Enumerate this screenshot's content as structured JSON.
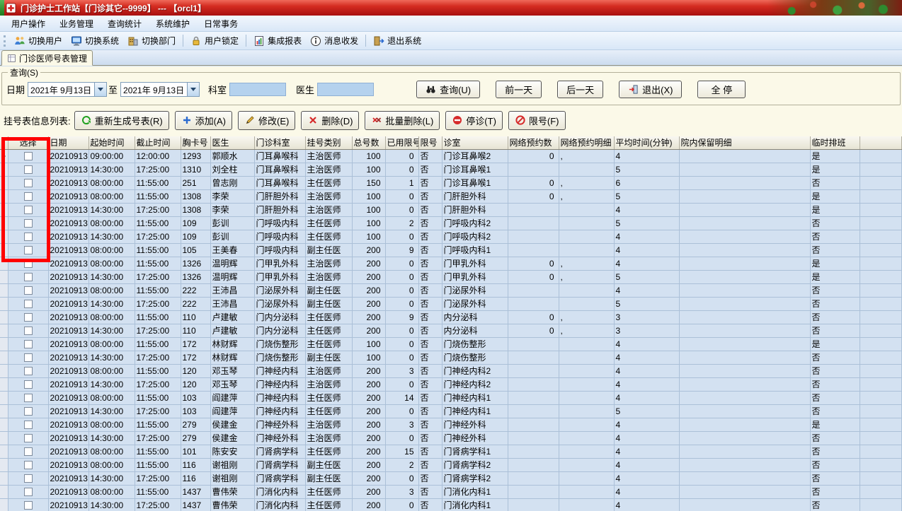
{
  "window": {
    "title": "门诊护士工作站【门诊其它--9999】 --- 【orcl1】"
  },
  "menu": {
    "items": [
      {
        "id": "user-ops",
        "label": "用户操作"
      },
      {
        "id": "business",
        "label": "业务管理"
      },
      {
        "id": "query-stats",
        "label": "查询统计"
      },
      {
        "id": "system-maint",
        "label": "系统维护"
      },
      {
        "id": "daily-affairs",
        "label": "日常事务"
      }
    ]
  },
  "toolbar": {
    "groups": [
      [
        {
          "id": "switch-user",
          "icon": "switch-user",
          "label": "切换用户"
        },
        {
          "id": "switch-system",
          "icon": "switch-system",
          "label": "切换系统"
        },
        {
          "id": "switch-dept",
          "icon": "switch-dept",
          "label": "切换部门"
        }
      ],
      [
        {
          "id": "lock-user",
          "icon": "lock-user",
          "label": "用户锁定"
        }
      ],
      [
        {
          "id": "integrated-report",
          "icon": "report",
          "label": "集成报表"
        },
        {
          "id": "messages",
          "icon": "message",
          "label": "消息收发"
        }
      ],
      [
        {
          "id": "exit-system",
          "icon": "exit",
          "label": "退出系统"
        }
      ]
    ]
  },
  "tabs": {
    "active": "门诊医师号表管理"
  },
  "query": {
    "group_label": "查询(S)",
    "date_label": "日期",
    "date_from": "2021年 9月13日",
    "to_label": "至",
    "date_to": "2021年 9月13日",
    "dept_label": "科室",
    "dept_value": "",
    "doctor_label": "医生",
    "doctor_value": "",
    "search_button": "查询(U)",
    "prev_day_button": "前一天",
    "next_day_button": "后一天",
    "exit_button": "退出(X)",
    "stop_all_button": "全 停"
  },
  "actions": {
    "label": "挂号表信息列表:",
    "buttons": [
      {
        "id": "regenerate",
        "icon": "refresh",
        "label": "重新生成号表(R)"
      },
      {
        "id": "add",
        "icon": "add",
        "label": "添加(A)"
      },
      {
        "id": "edit",
        "icon": "edit",
        "label": "修改(E)"
      },
      {
        "id": "delete",
        "icon": "delete",
        "label": "删除(D)"
      },
      {
        "id": "batch-delete",
        "icon": "batch-delete",
        "label": "批量删除(L)"
      },
      {
        "id": "stop-visit",
        "icon": "stop-visit",
        "label": "停诊(T)"
      },
      {
        "id": "limit-number",
        "icon": "limit",
        "label": "限号(F)"
      }
    ]
  },
  "table": {
    "columns": [
      "选择",
      "日期",
      "起始时间",
      "截止时间",
      "胸卡号",
      "医生",
      "门诊科室",
      "挂号类别",
      "总号数",
      "已用限号",
      "限号",
      "诊室",
      "网络预约数",
      "网络预约明细",
      "平均时间(分钟)",
      "院内保留明细",
      "临时排班"
    ],
    "rows": [
      [
        "20210913",
        "09:00:00",
        "12:00:00",
        "1293",
        "郭顺水",
        "门耳鼻喉科",
        "主治医师",
        "100",
        "0",
        "否",
        "门诊耳鼻喉2",
        "0",
        ",",
        "4",
        "",
        "是"
      ],
      [
        "20210913",
        "14:30:00",
        "17:25:00",
        "1310",
        "刘全柱",
        "门耳鼻喉科",
        "主治医师",
        "100",
        "0",
        "否",
        "门诊耳鼻喉1",
        "",
        "",
        "5",
        "",
        "是"
      ],
      [
        "20210913",
        "08:00:00",
        "11:55:00",
        "251",
        "曾志刚",
        "门耳鼻喉科",
        "主任医师",
        "150",
        "1",
        "否",
        "门诊耳鼻喉1",
        "0",
        ",",
        "6",
        "",
        "否"
      ],
      [
        "20210913",
        "08:00:00",
        "11:55:00",
        "1308",
        "李荣",
        "门肝胆外科",
        "主治医师",
        "100",
        "0",
        "否",
        "门肝胆外科",
        "0",
        ",",
        "5",
        "",
        "是"
      ],
      [
        "20210913",
        "14:30:00",
        "17:25:00",
        "1308",
        "李荣",
        "门肝胆外科",
        "主治医师",
        "100",
        "0",
        "否",
        "门肝胆外科",
        "",
        "",
        "4",
        "",
        "是"
      ],
      [
        "20210913",
        "08:00:00",
        "11:55:00",
        "109",
        "彭训",
        "门呼吸内科",
        "主任医师",
        "100",
        "2",
        "否",
        "门呼吸内科2",
        "",
        "",
        "5",
        "",
        "否"
      ],
      [
        "20210913",
        "14:30:00",
        "17:25:00",
        "109",
        "彭训",
        "门呼吸内科",
        "主任医师",
        "100",
        "0",
        "否",
        "门呼吸内科2",
        "",
        "",
        "4",
        "",
        "否"
      ],
      [
        "20210913",
        "08:00:00",
        "11:55:00",
        "105",
        "王美春",
        "门呼吸内科",
        "副主任医",
        "200",
        "9",
        "否",
        "门呼吸内科1",
        "",
        "",
        "4",
        "",
        "否"
      ],
      [
        "20210913",
        "08:00:00",
        "11:55:00",
        "1326",
        "温明辉",
        "门甲乳外科",
        "主治医师",
        "200",
        "0",
        "否",
        "门甲乳外科",
        "0",
        ",",
        "4",
        "",
        "是"
      ],
      [
        "20210913",
        "14:30:00",
        "17:25:00",
        "1326",
        "温明辉",
        "门甲乳外科",
        "主治医师",
        "200",
        "0",
        "否",
        "门甲乳外科",
        "0",
        ",",
        "5",
        "",
        "是"
      ],
      [
        "20210913",
        "08:00:00",
        "11:55:00",
        "222",
        "王沛昌",
        "门泌尿外科",
        "副主任医",
        "200",
        "0",
        "否",
        "门泌尿外科",
        "",
        "",
        "4",
        "",
        "否"
      ],
      [
        "20210913",
        "14:30:00",
        "17:25:00",
        "222",
        "王沛昌",
        "门泌尿外科",
        "副主任医",
        "200",
        "0",
        "否",
        "门泌尿外科",
        "",
        "",
        "5",
        "",
        "否"
      ],
      [
        "20210913",
        "08:00:00",
        "11:55:00",
        "110",
        "卢建敏",
        "门内分泌科",
        "主任医师",
        "200",
        "9",
        "否",
        "内分泌科",
        "0",
        ",",
        "3",
        "",
        "否"
      ],
      [
        "20210913",
        "14:30:00",
        "17:25:00",
        "110",
        "卢建敏",
        "门内分泌科",
        "主任医师",
        "200",
        "0",
        "否",
        "内分泌科",
        "0",
        ",",
        "3",
        "",
        "否"
      ],
      [
        "20210913",
        "08:00:00",
        "11:55:00",
        "172",
        "林财辉",
        "门烧伤整形",
        "主任医师",
        "100",
        "0",
        "否",
        "门烧伤整形",
        "",
        "",
        "4",
        "",
        "是"
      ],
      [
        "20210913",
        "14:30:00",
        "17:25:00",
        "172",
        "林财辉",
        "门烧伤整形",
        "副主任医",
        "100",
        "0",
        "否",
        "门烧伤整形",
        "",
        "",
        "4",
        "",
        "否"
      ],
      [
        "20210913",
        "08:00:00",
        "11:55:00",
        "120",
        "邓玉琴",
        "门神经内科",
        "主治医师",
        "200",
        "3",
        "否",
        "门神经内科2",
        "",
        "",
        "4",
        "",
        "否"
      ],
      [
        "20210913",
        "14:30:00",
        "17:25:00",
        "120",
        "邓玉琴",
        "门神经内科",
        "主治医师",
        "200",
        "0",
        "否",
        "门神经内科2",
        "",
        "",
        "4",
        "",
        "否"
      ],
      [
        "20210913",
        "08:00:00",
        "11:55:00",
        "103",
        "阎建萍",
        "门神经内科",
        "主任医师",
        "200",
        "14",
        "否",
        "门神经内科1",
        "",
        "",
        "4",
        "",
        "否"
      ],
      [
        "20210913",
        "14:30:00",
        "17:25:00",
        "103",
        "阎建萍",
        "门神经内科",
        "主任医师",
        "200",
        "0",
        "否",
        "门神经内科1",
        "",
        "",
        "5",
        "",
        "否"
      ],
      [
        "20210913",
        "08:00:00",
        "11:55:00",
        "279",
        "侯建金",
        "门神经外科",
        "主治医师",
        "200",
        "3",
        "否",
        "门神经外科",
        "",
        "",
        "4",
        "",
        "是"
      ],
      [
        "20210913",
        "14:30:00",
        "17:25:00",
        "279",
        "侯建金",
        "门神经外科",
        "主治医师",
        "200",
        "0",
        "否",
        "门神经外科",
        "",
        "",
        "4",
        "",
        "否"
      ],
      [
        "20210913",
        "08:00:00",
        "11:55:00",
        "101",
        "陈安安",
        "门肾病学科",
        "主任医师",
        "200",
        "15",
        "否",
        "门肾病学科1",
        "",
        "",
        "4",
        "",
        "否"
      ],
      [
        "20210913",
        "08:00:00",
        "11:55:00",
        "116",
        "谢祖刚",
        "门肾病学科",
        "副主任医",
        "200",
        "2",
        "否",
        "门肾病学科2",
        "",
        "",
        "4",
        "",
        "否"
      ],
      [
        "20210913",
        "14:30:00",
        "17:25:00",
        "116",
        "谢祖刚",
        "门肾病学科",
        "副主任医",
        "200",
        "0",
        "否",
        "门肾病学科2",
        "",
        "",
        "4",
        "",
        "否"
      ],
      [
        "20210913",
        "08:00:00",
        "11:55:00",
        "1437",
        "曹伟荣",
        "门消化内科",
        "主任医师",
        "200",
        "3",
        "否",
        "门消化内科1",
        "",
        "",
        "4",
        "",
        "否"
      ],
      [
        "20210913",
        "14:30:00",
        "17:25:00",
        "1437",
        "曹伟荣",
        "门消化内科",
        "主任医师",
        "200",
        "0",
        "否",
        "门消化内科1",
        "",
        "",
        "4",
        "",
        "否"
      ]
    ]
  },
  "colors": {
    "annotation_box": "#ff0000",
    "titlebar_red": "#c01818",
    "panel_cream": "#fbf9e8",
    "grid_row_blue": "#d3e1f1",
    "input_blue": "#b5d2ee"
  }
}
